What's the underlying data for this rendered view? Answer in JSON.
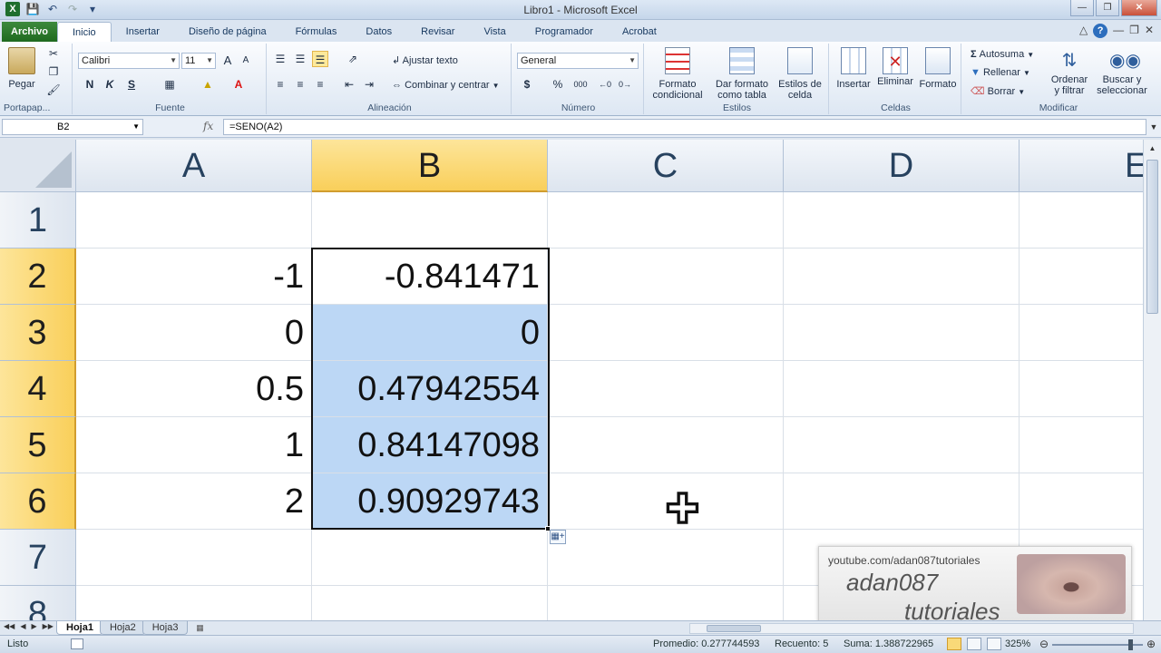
{
  "window": {
    "title": "Libro1 - Microsoft Excel"
  },
  "tabs": [
    {
      "label": "Archivo"
    },
    {
      "label": "Inicio"
    },
    {
      "label": "Insertar"
    },
    {
      "label": "Diseño de página"
    },
    {
      "label": "Fórmulas"
    },
    {
      "label": "Datos"
    },
    {
      "label": "Revisar"
    },
    {
      "label": "Vista"
    },
    {
      "label": "Programador"
    },
    {
      "label": "Acrobat"
    }
  ],
  "ribbon": {
    "clipboard": {
      "paste": "Pegar",
      "group": "Portapap..."
    },
    "font": {
      "name": "Calibri",
      "size": "11",
      "bold": "N",
      "italic": "K",
      "underline": "S",
      "grow": "A",
      "shrink": "A",
      "group": "Fuente"
    },
    "alignment": {
      "wrap": "Ajustar texto",
      "merge": "Combinar y centrar",
      "group": "Alineación"
    },
    "number": {
      "format": "General",
      "currency": "$",
      "percent": "%",
      "thousands": "000",
      "group": "Número"
    },
    "styles": {
      "conditional_1": "Formato",
      "conditional_2": "condicional",
      "table_1": "Dar formato",
      "table_2": "como tabla",
      "cell_1": "Estilos de",
      "cell_2": "celda",
      "group": "Estilos"
    },
    "cells": {
      "insert": "Insertar",
      "delete": "Eliminar",
      "format": "Formato",
      "group": "Celdas"
    },
    "editing": {
      "autosum": "Autosuma",
      "fill": "Rellenar",
      "clear": "Borrar",
      "sort_1": "Ordenar",
      "sort_2": "y filtrar",
      "find_1": "Buscar y",
      "find_2": "seleccionar",
      "group": "Modificar"
    }
  },
  "formula_bar": {
    "name_box": "B2",
    "fx": "fx",
    "formula": "=SENO(A2)"
  },
  "columns": [
    "A",
    "B",
    "C",
    "D",
    "E"
  ],
  "rows": [
    {
      "num": "1",
      "a": "",
      "b": ""
    },
    {
      "num": "2",
      "a": "-1",
      "b": "-0.841471"
    },
    {
      "num": "3",
      "a": "0",
      "b": "0"
    },
    {
      "num": "4",
      "a": "0.5",
      "b": "0.47942554"
    },
    {
      "num": "5",
      "a": "1",
      "b": "0.84147098"
    },
    {
      "num": "6",
      "a": "2",
      "b": "0.90929743"
    },
    {
      "num": "7",
      "a": "",
      "b": ""
    },
    {
      "num": "8",
      "a": "",
      "b": ""
    }
  ],
  "sheets": [
    {
      "label": "Hoja1"
    },
    {
      "label": "Hoja2"
    },
    {
      "label": "Hoja3"
    }
  ],
  "status": {
    "ready": "Listo",
    "average": "Promedio: 0.277744593",
    "count": "Recuento: 5",
    "sum": "Suma: 1.388722965",
    "zoom": "325%"
  },
  "watermark": {
    "url": "youtube.com/adan087tutoriales",
    "brand": "adan087",
    "sub": "tutoriales"
  }
}
